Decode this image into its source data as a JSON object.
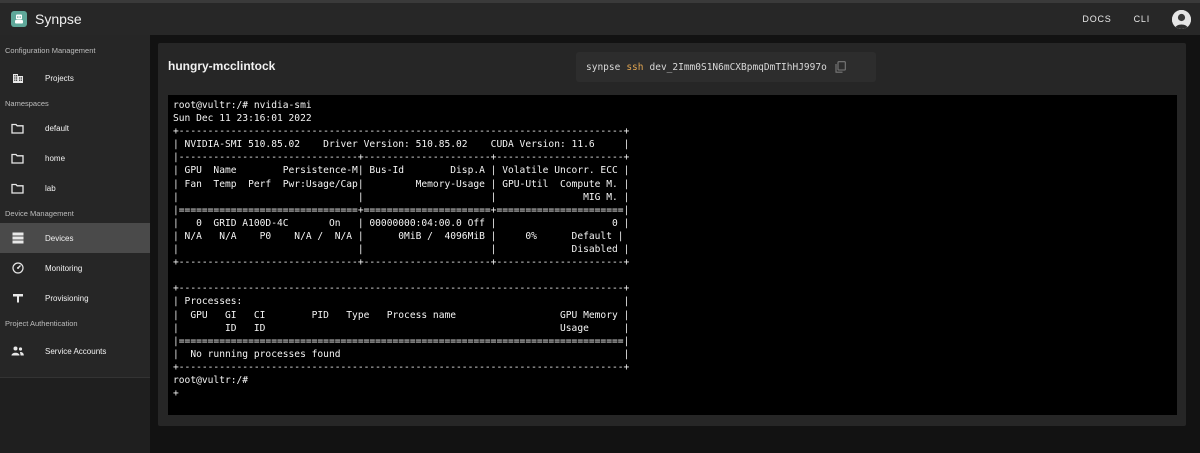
{
  "app": {
    "title": "Synpse"
  },
  "topbar": {
    "docs_label": "DOCS",
    "cli_label": "CLI"
  },
  "sidebar": {
    "sections": [
      {
        "label": "Configuration Management",
        "items": [
          {
            "label": "Projects",
            "icon": "building-icon"
          }
        ]
      },
      {
        "label": "Namespaces",
        "items": [
          {
            "label": "default",
            "icon": "folder-icon"
          },
          {
            "label": "home",
            "icon": "folder-icon"
          },
          {
            "label": "lab",
            "icon": "folder-icon"
          }
        ]
      },
      {
        "label": "Device Management",
        "items": [
          {
            "label": "Devices",
            "icon": "devices-icon",
            "active": true
          },
          {
            "label": "Monitoring",
            "icon": "gauge-icon"
          },
          {
            "label": "Provisioning",
            "icon": "provisioning-icon"
          }
        ]
      },
      {
        "label": "Project Authentication",
        "items": [
          {
            "label": "Service Accounts",
            "icon": "people-icon"
          }
        ]
      }
    ]
  },
  "device": {
    "name": "hungry-mcclintock",
    "ssh": {
      "cmd": "synpse",
      "sub": "ssh",
      "id": "dev_2Imm0S1N6mCXBpmqDmTIhHJ997o"
    }
  },
  "terminal": {
    "lines": [
      "root@vultr:/# nvidia-smi",
      "Sun Dec 11 23:16:01 2022",
      "+-----------------------------------------------------------------------------+",
      "| NVIDIA-SMI 510.85.02    Driver Version: 510.85.02    CUDA Version: 11.6     |",
      "|-------------------------------+----------------------+----------------------+",
      "| GPU  Name        Persistence-M| Bus-Id        Disp.A | Volatile Uncorr. ECC |",
      "| Fan  Temp  Perf  Pwr:Usage/Cap|         Memory-Usage | GPU-Util  Compute M. |",
      "|                               |                      |               MIG M. |",
      "|===============================+======================+======================|",
      "|   0  GRID A100D-4C       On   | 00000000:04:00.0 Off |                    0 |",
      "| N/A   N/A    P0    N/A /  N/A |      0MiB /  4096MiB |     0%      Default |",
      "|                               |                      |             Disabled |",
      "+-------------------------------+----------------------+----------------------+",
      "",
      "+-----------------------------------------------------------------------------+",
      "| Processes:                                                                  |",
      "|  GPU   GI   CI        PID   Type   Process name                  GPU Memory |",
      "|        ID   ID                                                   Usage      |",
      "|=============================================================================|",
      "|  No running processes found                                                 |",
      "+-----------------------------------------------------------------------------+",
      "root@vultr:/# ",
      "+"
    ]
  }
}
